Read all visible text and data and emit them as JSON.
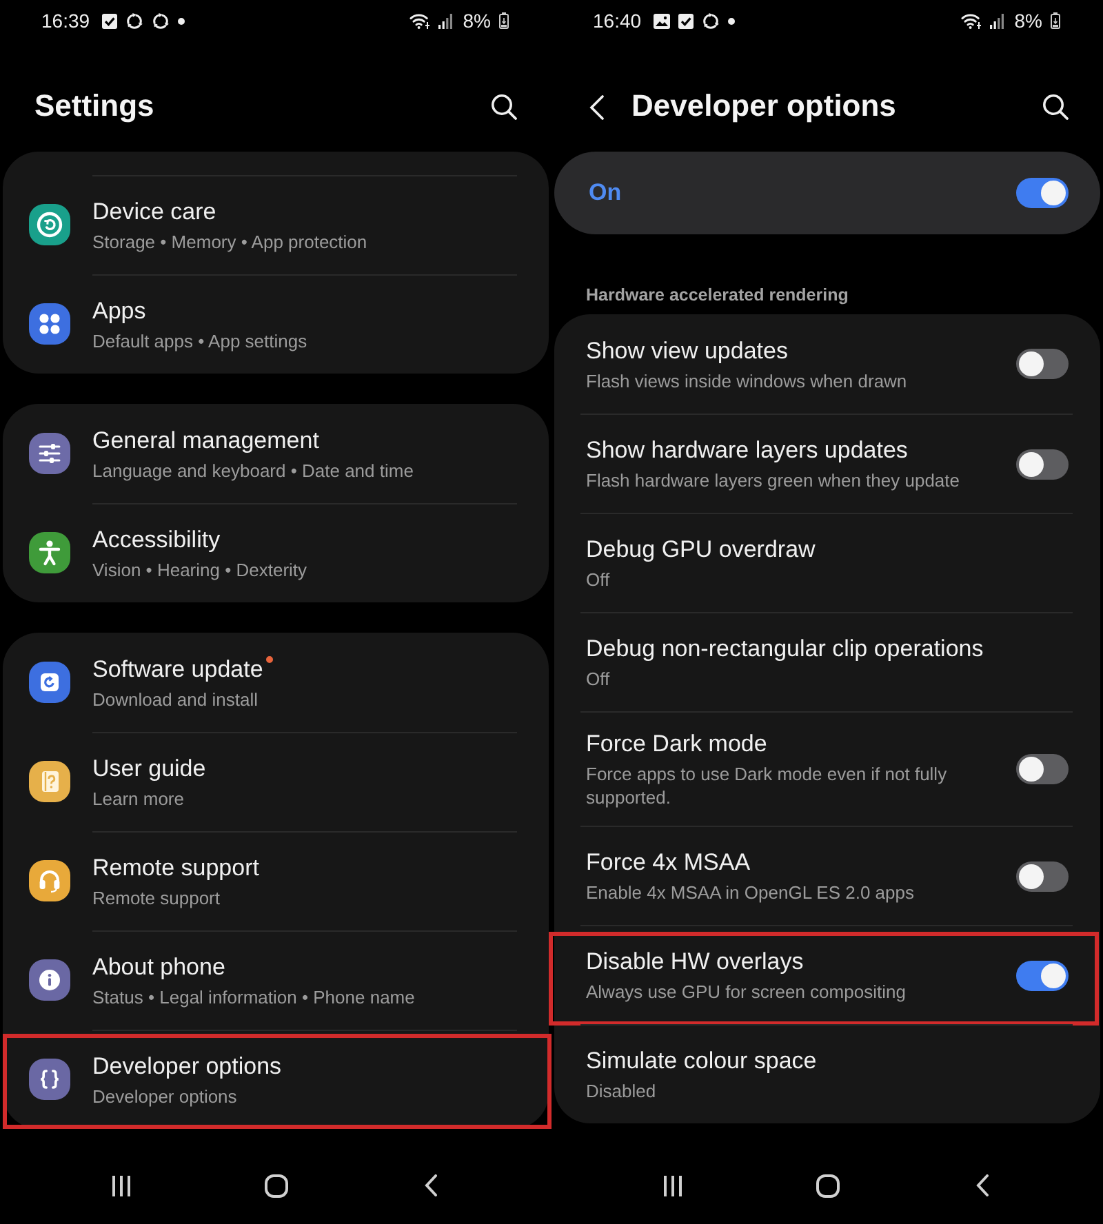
{
  "left_screen": {
    "status_bar": {
      "time": "16:39",
      "battery": "8%"
    },
    "title": "Settings",
    "groups": [
      {
        "cut_off_above": true,
        "items": [
          {
            "title": "Device care",
            "subtitle": "Storage • Memory • App protection",
            "color": "#19a08b",
            "notification_dot": false,
            "highlighted": false
          },
          {
            "title": "Apps",
            "subtitle": "Default apps • App settings",
            "color": "#3d6fe0",
            "notification_dot": false,
            "highlighted": false
          }
        ]
      },
      {
        "cut_off_above": false,
        "items": [
          {
            "title": "General management",
            "subtitle": "Language and keyboard • Date and time",
            "color": "#6d6ba8",
            "notification_dot": false,
            "highlighted": false
          },
          {
            "title": "Accessibility",
            "subtitle": "Vision • Hearing • Dexterity",
            "color": "#3f9b3a",
            "notification_dot": false,
            "highlighted": false
          }
        ]
      },
      {
        "cut_off_above": false,
        "items": [
          {
            "title": "Software update",
            "subtitle": "Download and install",
            "color": "#3d6fe0",
            "notification_dot": true,
            "highlighted": false
          },
          {
            "title": "User guide",
            "subtitle": "Learn more",
            "color": "#e6b04a",
            "notification_dot": false,
            "highlighted": false
          },
          {
            "title": "Remote support",
            "subtitle": "Remote support",
            "color": "#e8a93a",
            "notification_dot": false,
            "highlighted": false
          },
          {
            "title": "About phone",
            "subtitle": "Status • Legal information • Phone name",
            "color": "#6a68a4",
            "notification_dot": false,
            "highlighted": false
          },
          {
            "title": "Developer options",
            "subtitle": "Developer options",
            "color": "#6a68a4",
            "notification_dot": false,
            "highlighted": true
          }
        ]
      }
    ]
  },
  "right_screen": {
    "status_bar": {
      "time": "16:40",
      "battery": "8%"
    },
    "title": "Developer options",
    "master_switch": {
      "label": "On",
      "on": true
    },
    "section_header": "Hardware accelerated rendering",
    "settings": [
      {
        "kind": "switch",
        "title": "Show view updates",
        "subtitle": "Flash views inside windows when drawn",
        "on": false,
        "highlighted": false
      },
      {
        "kind": "switch",
        "title": "Show hardware layers updates",
        "subtitle": "Flash hardware layers green when they update",
        "on": false,
        "highlighted": false
      },
      {
        "kind": "value",
        "title": "Debug GPU overdraw",
        "subtitle": "Off",
        "highlighted": false
      },
      {
        "kind": "value",
        "title": "Debug non-rectangular clip operations",
        "subtitle": "Off",
        "highlighted": false
      },
      {
        "kind": "switch",
        "title": "Force Dark mode",
        "subtitle": "Force apps to use Dark mode even if not fully supported.",
        "on": false,
        "highlighted": false
      },
      {
        "kind": "switch",
        "title": "Force 4x MSAA",
        "subtitle": "Enable 4x MSAA in OpenGL ES 2.0 apps",
        "on": false,
        "highlighted": false
      },
      {
        "kind": "switch",
        "title": "Disable HW overlays",
        "subtitle": "Always use GPU for screen compositing",
        "on": true,
        "highlighted": true
      },
      {
        "kind": "value",
        "title": "Simulate colour space",
        "subtitle": "Disabled",
        "highlighted": false
      }
    ]
  }
}
